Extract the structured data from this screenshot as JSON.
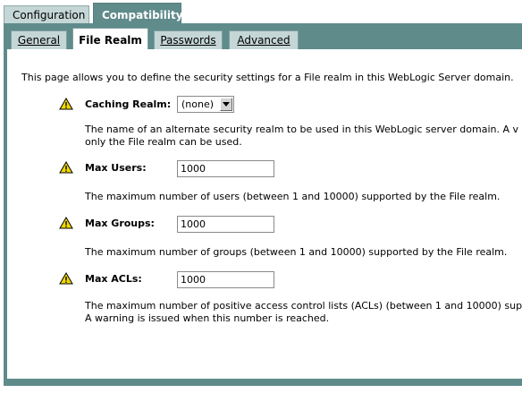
{
  "top_tabs": [
    "Configuration",
    "Compatibility"
  ],
  "sub_tabs": [
    "General",
    "File Realm",
    "Passwords",
    "Advanced"
  ],
  "intro": "This page allows you to define the security settings for a File realm in this WebLogic Server domain.",
  "fields": {
    "caching_realm": {
      "label": "Caching Realm:",
      "value": "(none)",
      "help_line1": "The name of an alternate security realm to be used in this WebLogic server domain. A v",
      "help_line2": "only the File realm can be used."
    },
    "max_users": {
      "label": "Max Users:",
      "value": "1000",
      "help_line1": "The maximum number of users (between 1 and 10000) supported by the File realm."
    },
    "max_groups": {
      "label": "Max Groups:",
      "value": "1000",
      "help_line1": "The maximum number of groups (between 1 and 10000) supported by the File realm."
    },
    "max_acls": {
      "label": "Max ACLs:",
      "value": "1000",
      "help_line1": "The maximum number of positive access control lists (ACLs) (between 1 and 10000) sup",
      "help_line2": "A warning is issued when this number is reached."
    }
  },
  "icons": {
    "field_warning": "warning-icon"
  },
  "colors": {
    "frame": "#5f8b8b",
    "tab_inactive": "#c5d6d6",
    "warning": "#f0d800"
  }
}
